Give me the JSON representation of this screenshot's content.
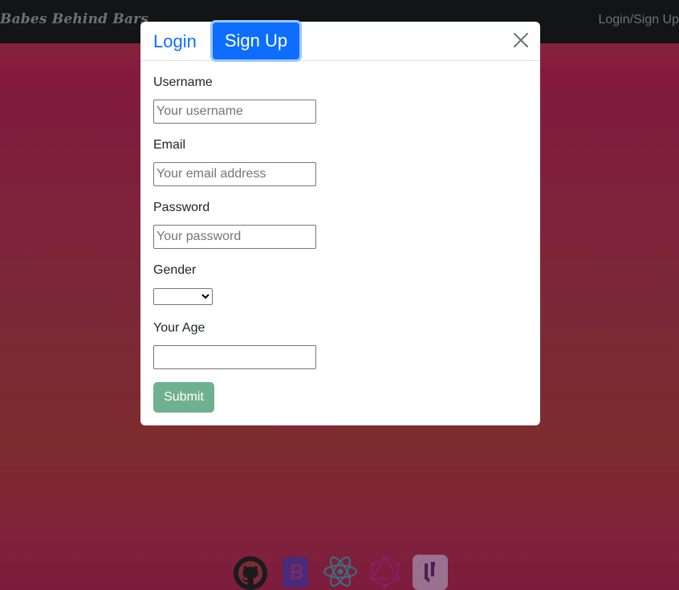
{
  "navbar": {
    "brand": "Babes Behind Bars",
    "auth_link": "Login/Sign Up"
  },
  "modal": {
    "tabs": {
      "login": "Login",
      "signup": "Sign Up"
    },
    "active_tab": "signup",
    "close_icon": "close-icon",
    "fields": {
      "username": {
        "label": "Username",
        "placeholder": "Your username",
        "value": ""
      },
      "email": {
        "label": "Email",
        "placeholder": "Your email address",
        "value": ""
      },
      "password": {
        "label": "Password",
        "placeholder": "Your password",
        "value": ""
      },
      "gender": {
        "label": "Gender",
        "selected": ""
      },
      "age": {
        "label": "Your Age",
        "value": ""
      }
    },
    "submit_label": "Submit"
  },
  "footer": {
    "icons": [
      "github-icon",
      "bootstrap-icon",
      "react-icon",
      "graphql-icon",
      "heroku-icon"
    ]
  },
  "colors": {
    "primary": "#0d6efd",
    "submit": "#6fb08f",
    "navbar": "#131417",
    "background": "#7f1d3e"
  }
}
